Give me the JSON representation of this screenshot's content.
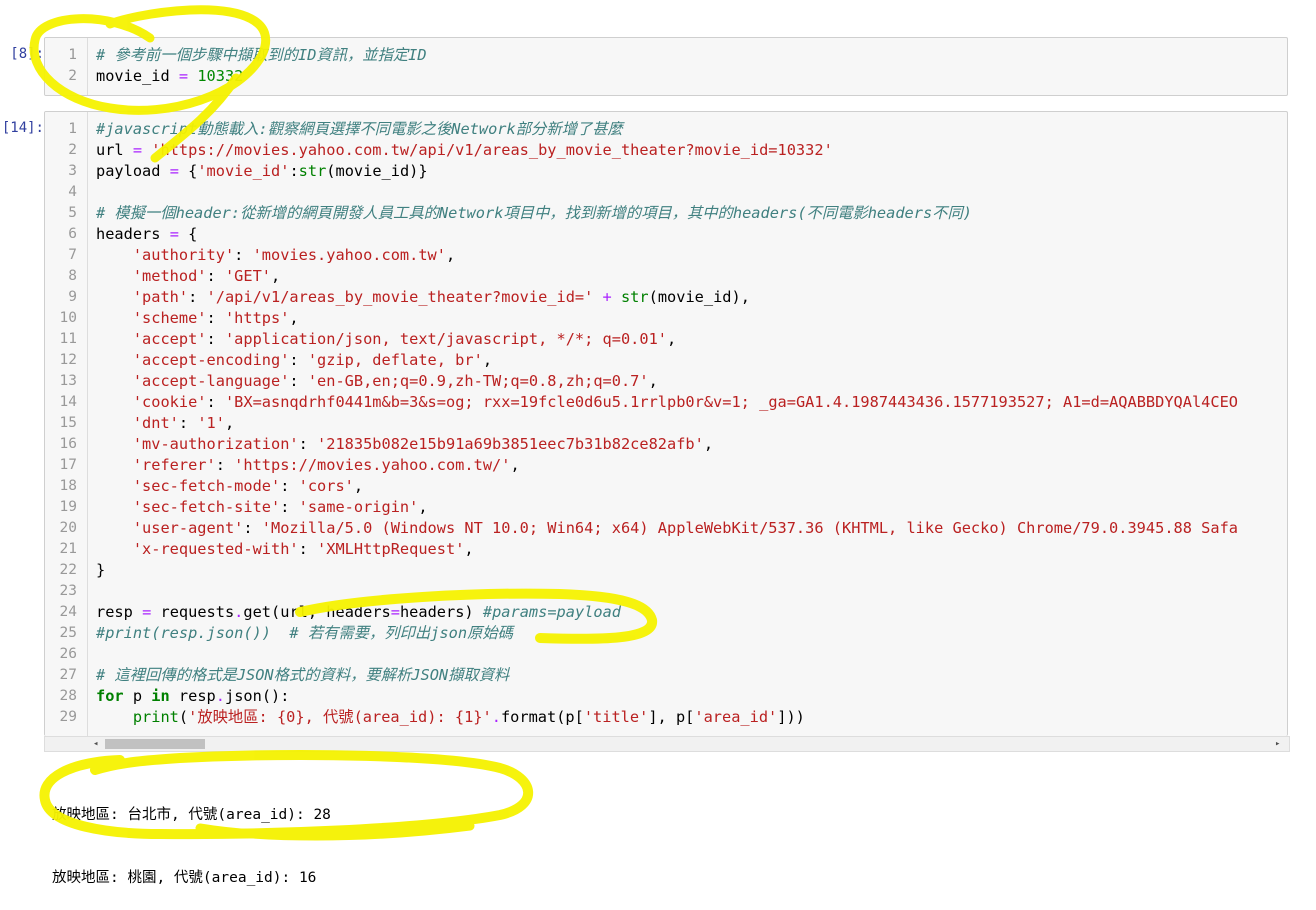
{
  "cell8": {
    "prompt": "[8]:",
    "lines": [
      {
        "n": "1",
        "t": [
          [
            "cm",
            "# 參考前一個步驟中擷取到的ID資訊，並指定ID"
          ]
        ]
      },
      {
        "n": "2",
        "t": [
          [
            "",
            "movie_id "
          ],
          [
            "op",
            "="
          ],
          [
            "nu",
            " 10332"
          ]
        ]
      }
    ]
  },
  "cell14": {
    "prompt": "[14]:",
    "lines": [
      {
        "n": "1",
        "t": [
          [
            "cm",
            "#javascript動態載入:觀察網頁選擇不同電影之後Network部分新增了甚麼"
          ]
        ]
      },
      {
        "n": "2",
        "t": [
          [
            "",
            "url "
          ],
          [
            "op",
            "="
          ],
          [
            "st",
            " 'https://movies.yahoo.com.tw/api/v1/areas_by_movie_theater?movie_id=10332'"
          ]
        ]
      },
      {
        "n": "3",
        "t": [
          [
            "",
            "payload "
          ],
          [
            "op",
            "="
          ],
          [
            "",
            " {"
          ],
          [
            "st",
            "'movie_id'"
          ],
          [
            "",
            ":"
          ],
          [
            "bi",
            "str"
          ],
          [
            "",
            "(movie_id)}"
          ]
        ]
      },
      {
        "n": "4",
        "t": []
      },
      {
        "n": "5",
        "t": [
          [
            "cm",
            "# 模擬一個header:從新增的網頁開發人員工具的Network項目中，找到新增的項目，其中的headers(不同電影headers不同)"
          ]
        ]
      },
      {
        "n": "6",
        "t": [
          [
            "",
            "headers "
          ],
          [
            "op",
            "="
          ],
          [
            "",
            " {"
          ]
        ]
      },
      {
        "n": "7",
        "t": [
          [
            "",
            "    "
          ],
          [
            "st",
            "'authority'"
          ],
          [
            "",
            ": "
          ],
          [
            "st",
            "'movies.yahoo.com.tw'"
          ],
          [
            "",
            ","
          ]
        ]
      },
      {
        "n": "8",
        "t": [
          [
            "",
            "    "
          ],
          [
            "st",
            "'method'"
          ],
          [
            "",
            ": "
          ],
          [
            "st",
            "'GET'"
          ],
          [
            "",
            ","
          ]
        ]
      },
      {
        "n": "9",
        "t": [
          [
            "",
            "    "
          ],
          [
            "st",
            "'path'"
          ],
          [
            "",
            ": "
          ],
          [
            "st",
            "'/api/v1/areas_by_movie_theater?movie_id='"
          ],
          [
            "op",
            " +"
          ],
          [
            "bi",
            " str"
          ],
          [
            "",
            "(movie_id),"
          ]
        ]
      },
      {
        "n": "10",
        "t": [
          [
            "",
            "    "
          ],
          [
            "st",
            "'scheme'"
          ],
          [
            "",
            ": "
          ],
          [
            "st",
            "'https'"
          ],
          [
            "",
            ","
          ]
        ]
      },
      {
        "n": "11",
        "t": [
          [
            "",
            "    "
          ],
          [
            "st",
            "'accept'"
          ],
          [
            "",
            ": "
          ],
          [
            "st",
            "'application/json, text/javascript, */*; q=0.01'"
          ],
          [
            "",
            ","
          ]
        ]
      },
      {
        "n": "12",
        "t": [
          [
            "",
            "    "
          ],
          [
            "st",
            "'accept-encoding'"
          ],
          [
            "",
            ": "
          ],
          [
            "st",
            "'gzip, deflate, br'"
          ],
          [
            "",
            ","
          ]
        ]
      },
      {
        "n": "13",
        "t": [
          [
            "",
            "    "
          ],
          [
            "st",
            "'accept-language'"
          ],
          [
            "",
            ": "
          ],
          [
            "st",
            "'en-GB,en;q=0.9,zh-TW;q=0.8,zh;q=0.7'"
          ],
          [
            "",
            ","
          ]
        ]
      },
      {
        "n": "14",
        "t": [
          [
            "",
            "    "
          ],
          [
            "st",
            "'cookie'"
          ],
          [
            "",
            ": "
          ],
          [
            "st",
            "'BX=asnqdrhf0441m&b=3&s=og; rxx=19fcle0d6u5.1rrlpb0r&v=1; _ga=GA1.4.1987443436.1577193527; A1=d=AQABBDYQAl4CEO"
          ]
        ]
      },
      {
        "n": "15",
        "t": [
          [
            "",
            "    "
          ],
          [
            "st",
            "'dnt'"
          ],
          [
            "",
            ": "
          ],
          [
            "st",
            "'1'"
          ],
          [
            "",
            ","
          ]
        ]
      },
      {
        "n": "16",
        "t": [
          [
            "",
            "    "
          ],
          [
            "st",
            "'mv-authorization'"
          ],
          [
            "",
            ": "
          ],
          [
            "st",
            "'21835b082e15b91a69b3851eec7b31b82ce82afb'"
          ],
          [
            "",
            ","
          ]
        ]
      },
      {
        "n": "17",
        "t": [
          [
            "",
            "    "
          ],
          [
            "st",
            "'referer'"
          ],
          [
            "",
            ": "
          ],
          [
            "st",
            "'https://movies.yahoo.com.tw/'"
          ],
          [
            "",
            ","
          ]
        ]
      },
      {
        "n": "18",
        "t": [
          [
            "",
            "    "
          ],
          [
            "st",
            "'sec-fetch-mode'"
          ],
          [
            "",
            ": "
          ],
          [
            "st",
            "'cors'"
          ],
          [
            "",
            ","
          ]
        ]
      },
      {
        "n": "19",
        "t": [
          [
            "",
            "    "
          ],
          [
            "st",
            "'sec-fetch-site'"
          ],
          [
            "",
            ": "
          ],
          [
            "st",
            "'same-origin'"
          ],
          [
            "",
            ","
          ]
        ]
      },
      {
        "n": "20",
        "t": [
          [
            "",
            "    "
          ],
          [
            "st",
            "'user-agent'"
          ],
          [
            "",
            ": "
          ],
          [
            "st",
            "'Mozilla/5.0 (Windows NT 10.0; Win64; x64) AppleWebKit/537.36 (KHTML, like Gecko) Chrome/79.0.3945.88 Safa"
          ]
        ]
      },
      {
        "n": "21",
        "t": [
          [
            "",
            "    "
          ],
          [
            "st",
            "'x-requested-with'"
          ],
          [
            "",
            ": "
          ],
          [
            "st",
            "'XMLHttpRequest'"
          ],
          [
            "",
            ","
          ]
        ]
      },
      {
        "n": "22",
        "t": [
          [
            "",
            "}"
          ]
        ]
      },
      {
        "n": "23",
        "t": []
      },
      {
        "n": "24",
        "t": [
          [
            "",
            "resp "
          ],
          [
            "op",
            "="
          ],
          [
            "",
            " requests"
          ],
          [
            "op",
            "."
          ],
          [
            "",
            "get(url, headers"
          ],
          [
            "op",
            "="
          ],
          [
            "",
            "headers) "
          ],
          [
            "cm",
            "#params=payload"
          ]
        ]
      },
      {
        "n": "25",
        "t": [
          [
            "cm",
            "#print(resp.json())  # 若有需要，列印出json原始碼"
          ]
        ]
      },
      {
        "n": "26",
        "t": []
      },
      {
        "n": "27",
        "t": [
          [
            "cm",
            "# 這裡回傳的格式是JSON格式的資料，要解析JSON擷取資料"
          ]
        ]
      },
      {
        "n": "28",
        "t": [
          [
            "kw",
            "for"
          ],
          [
            "",
            " p "
          ],
          [
            "kw",
            "in"
          ],
          [
            "",
            " resp"
          ],
          [
            "op",
            "."
          ],
          [
            "",
            "json():"
          ]
        ]
      },
      {
        "n": "29",
        "t": [
          [
            "",
            "    "
          ],
          [
            "bi",
            "print"
          ],
          [
            "",
            "("
          ],
          [
            "st",
            "'放映地區: {0}, 代號(area_id): {1}'"
          ],
          [
            "op",
            "."
          ],
          [
            "",
            "format(p["
          ],
          [
            "st",
            "'title'"
          ],
          [
            "",
            "], p["
          ],
          [
            "st",
            "'area_id'"
          ],
          [
            "",
            "]))"
          ]
        ]
      }
    ]
  },
  "output": {
    "lines": [
      "放映地區: 台北市, 代號(area_id): 28",
      "放映地區: 桃園, 代號(area_id): 16"
    ]
  },
  "scrollbar": {
    "left_arrow": "◂",
    "right_arrow": "▸"
  }
}
